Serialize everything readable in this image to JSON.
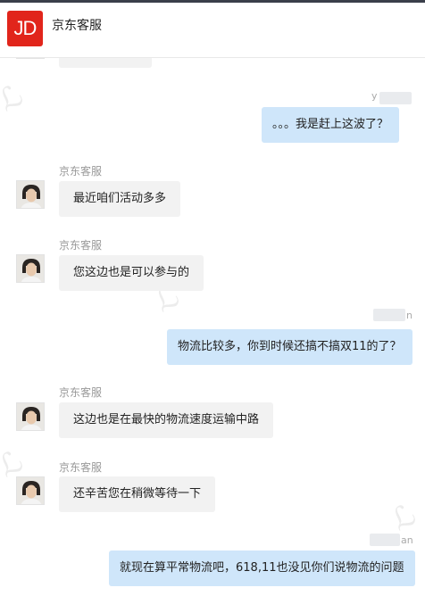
{
  "header": {
    "logo_text": "JD",
    "title": "京东客服",
    "brand_color": "#e1251b"
  },
  "bubble_colors": {
    "incoming": "#f2f2f2",
    "outgoing": "#cfe6fa"
  },
  "messages": [
    {
      "side": "in",
      "sender": "京东客服",
      "text": "最近咱们活动多多"
    },
    {
      "side": "in",
      "sender": "京东客服",
      "text": "您这边也是可以参与的"
    },
    {
      "side": "out",
      "sender_tail": "n",
      "text": "物流比较多，你到时候还搞不搞双11的了？"
    },
    {
      "side": "in",
      "sender": "京东客服",
      "text": "这边也是在最快的物流速度运输中路"
    },
    {
      "side": "in",
      "sender": "京东客服",
      "text": "还辛苦您在稍微等待一下"
    },
    {
      "side": "out",
      "sender_tail": "an",
      "text": "就现在算平常物流吧，618,11也没见你们说物流的问题"
    }
  ],
  "partial_top": {
    "sender_tail": "y",
    "text": "。。。我是赶上这波了？"
  }
}
